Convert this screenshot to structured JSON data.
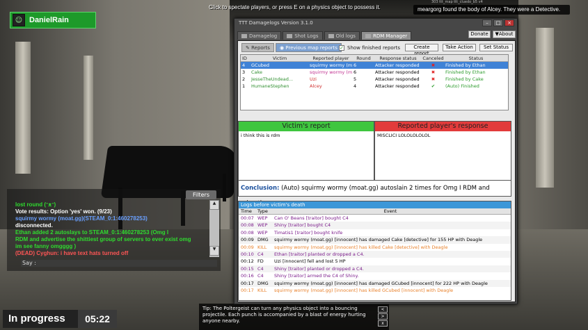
{
  "hud": {
    "player_name": "DanielRain",
    "top_message": "Click to spectate players, or press E on a physics object to possess it.",
    "killfeed": "meargorg found the body of Alcey. They were a Detective.",
    "killfeed_small": "303 ttt_map ttt_cluedo_b5 v4",
    "round_state": "In progress",
    "timer": "05:22",
    "tip": "Tip: The Poltergeist can turn any physics object into a bouncing projectile. Each punch is accompanied by a blast of energy hurting anyone nearby."
  },
  "chat": {
    "filters_label": "Filters",
    "say_label": "Say :",
    "lines": [
      {
        "text": "lost round (ᵔᴥᵔ)",
        "color": "#2fdc2f"
      },
      {
        "text": "Vote results: Option 'yes' won. (9/23)",
        "color": "#ffffff"
      },
      {
        "text": "squirmy wormy (moat.gg)(STEAM_0:1:460278253)",
        "color": "#6aa0ff"
      },
      {
        "text": "disconnected.",
        "color": "#ffffff"
      },
      {
        "text": "Ethan added 2 autoslays to STEAM_0:1:460278253 (Omg I",
        "color": "#2fdc2f"
      },
      {
        "text": "RDM and advertise the shittiest group of servers to ever exist omg",
        "color": "#2fdc2f"
      },
      {
        "text": "im see fanny omgggg )",
        "color": "#2fdc2f"
      },
      {
        "text": "(DEAD) Cyghun: i have text hats turned off",
        "color": "#ff5555"
      }
    ]
  },
  "window": {
    "title": "TTT Damagelogs Version 3.1.0",
    "tabs": [
      "Damagelog",
      "Shot Logs",
      "Old logs",
      "RDM Manager"
    ],
    "donate_label": "Donate",
    "about_label": "▼About",
    "subtabs": [
      "Reports",
      "Previous map reports"
    ],
    "show_finished_label": "Show finished reports",
    "create_report_label": "Create report",
    "take_action_label": "Take Action",
    "set_status_label": "Set Status",
    "report_columns": [
      "ID",
      "Victim",
      "Reported player",
      "Round",
      "Response status",
      "Canceled",
      "Status"
    ],
    "reports": [
      {
        "id": "4",
        "victim": "GCubed",
        "reported": "squirmy wormy (mo...",
        "round": "6",
        "response": "Attacker responded",
        "canceled": "x",
        "status": "Finished by Ethan",
        "victim_color": "#2f8f2f",
        "reported_color": "#c03090",
        "selected": true
      },
      {
        "id": "3",
        "victim": "Cake",
        "reported": "squirmy wormy (mo...",
        "round": "6",
        "response": "Attacker responded",
        "canceled": "x",
        "status": "Finished by Ethan",
        "victim_color": "#2f8f2f",
        "reported_color": "#c03090",
        "selected": false
      },
      {
        "id": "2",
        "victim": "JesseTheUndead...",
        "reported": "Uzi",
        "round": "5",
        "response": "Attacker responded",
        "canceled": "x",
        "status": "Finished by Cake",
        "victim_color": "#2f8f2f",
        "reported_color": "#d03030",
        "selected": false
      },
      {
        "id": "1",
        "victim": "HumaneStephen",
        "reported": "Alcey",
        "round": "4",
        "response": "Attacker responded",
        "canceled": "check",
        "status": "(Auto) Finished",
        "victim_color": "#2f8f2f",
        "reported_color": "#d03030",
        "selected": false
      }
    ],
    "victim_report_title": "Victim's report",
    "victim_report_text": "i think this is rdm",
    "reported_response_title": "Reported player's response",
    "reported_response_text": "MISCLICI LOLOLOLOLOL",
    "conclusion_label": "Conclusion:",
    "conclusion_text": "(Auto) squirmy wormy (moat.gg) autoslain 2 times for Omg I RDM and advertise",
    "logs_title": "Logs before victim's death",
    "log_columns": [
      "Time",
      "Type",
      "Event"
    ],
    "logs": [
      {
        "time": "00:07",
        "type": "WEP",
        "event": "Can O' Beans [traitor] bought C4",
        "color": "#7a1a8a"
      },
      {
        "time": "00:08",
        "type": "WEP",
        "event": "Shiny [traitor] bought C4",
        "color": "#7a1a8a"
      },
      {
        "time": "00:08",
        "type": "WEP",
        "event": "Timatis1 [traitor] bought knife",
        "color": "#7a1a8a"
      },
      {
        "time": "00:09",
        "type": "DMG",
        "event": "squirmy wormy (moat.gg) [innocent] has damaged Cake [detective] for 155 HP with Deagle",
        "color": "#000000"
      },
      {
        "time": "00:09",
        "type": "KILL",
        "event": "squirmy wormy (moat.gg) [innocent] has killed Cake [detective] with Deagle",
        "color": "#e8802a"
      },
      {
        "time": "00:10",
        "type": "C4",
        "event": "Ethan [traitor] planted or dropped a C4.",
        "color": "#7a1a8a"
      },
      {
        "time": "00:12",
        "type": "FD",
        "event": "Uzi [innocent] fell and lost 5 HP",
        "color": "#000000"
      },
      {
        "time": "00:15",
        "type": "C4",
        "event": "Shiny [traitor] planted or dropped a C4.",
        "color": "#7a1a8a"
      },
      {
        "time": "00:16",
        "type": "C4",
        "event": "Shiny [traitor] armed the C4 of Shiny.",
        "color": "#7a1a8a"
      },
      {
        "time": "00:17",
        "type": "DMG",
        "event": "squirmy wormy (moat.gg) [innocent] has damaged GCubed [innocent] for 222 HP with Deagle",
        "color": "#000000"
      },
      {
        "time": "00:17",
        "type": "KILL",
        "event": "squirmy wormy (moat.gg) [innocent] has killed GCubed [innocent] with Deagle",
        "color": "#e8802a"
      }
    ]
  }
}
